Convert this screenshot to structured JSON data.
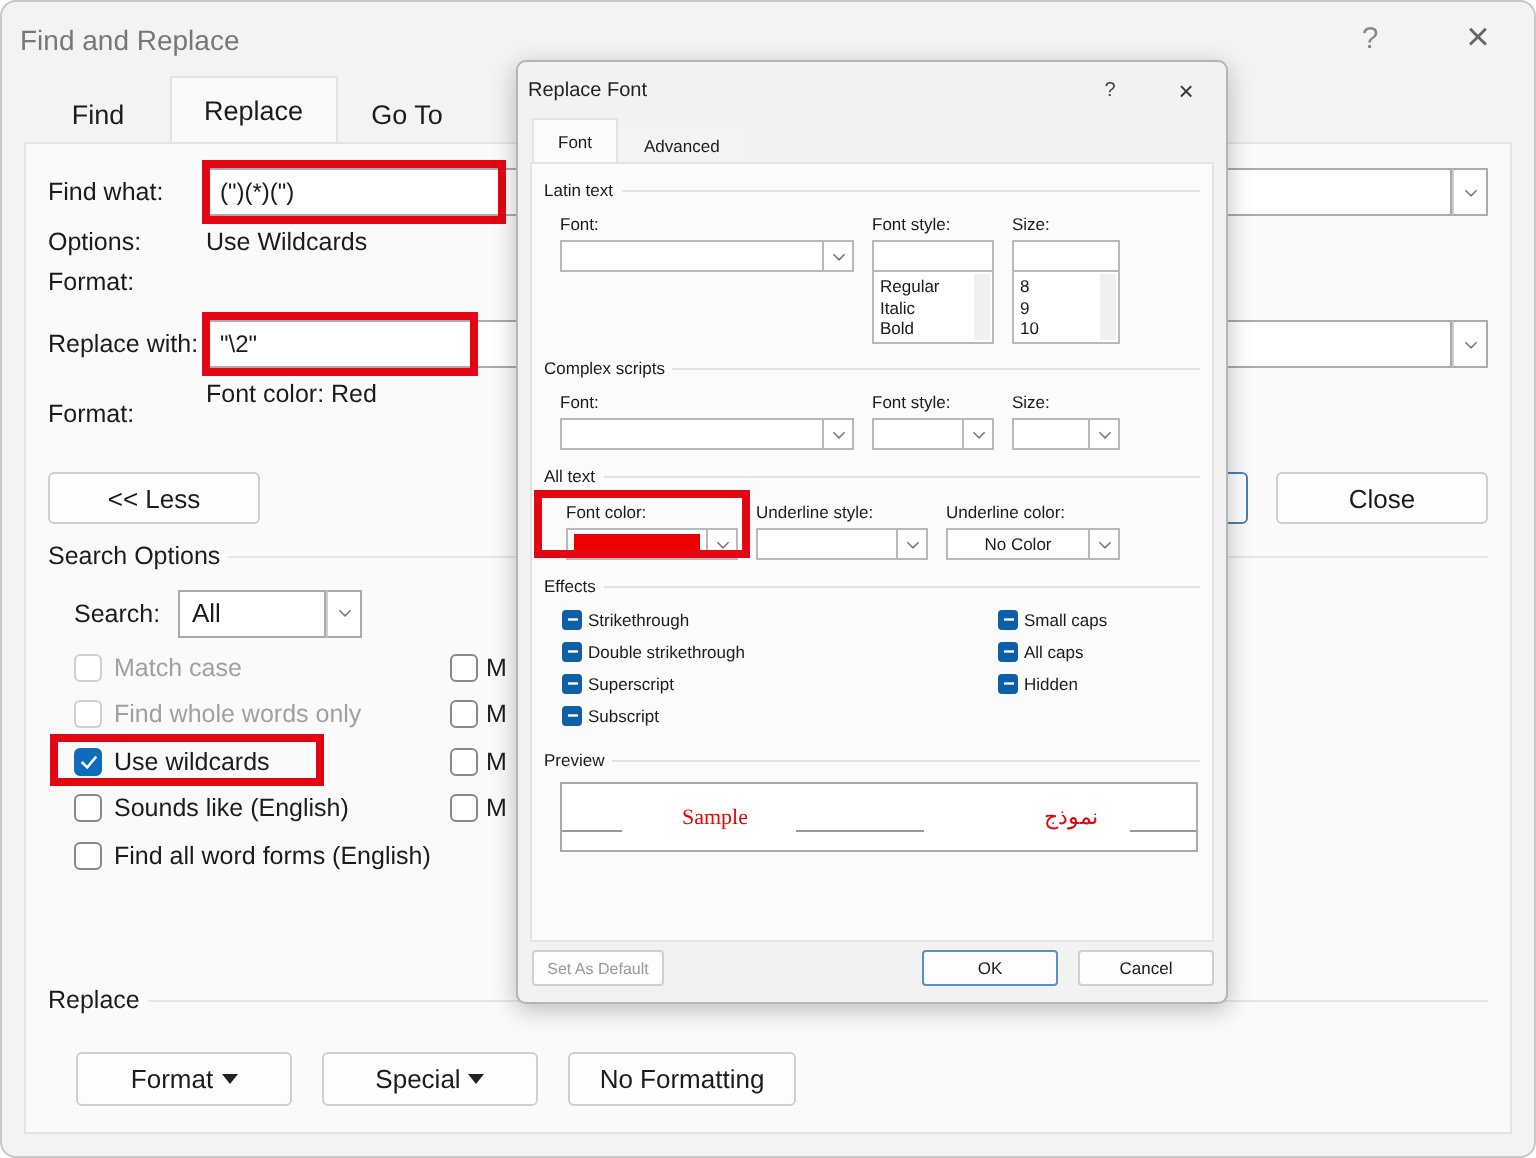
{
  "window": {
    "title": "Find and Replace",
    "help": "?",
    "close": "×"
  },
  "tabs": [
    {
      "label": "Find",
      "selected": false
    },
    {
      "label": "Replace",
      "selected": true
    },
    {
      "label": "Go To",
      "selected": false
    }
  ],
  "find": {
    "label": "Find what:",
    "value": "(\")(*)(\")",
    "highlighted": true,
    "options_label": "Options:",
    "options": "Use Wildcards",
    "format_label": "Format:"
  },
  "replace": {
    "label": "Replace with:",
    "value": "\"\\2\"",
    "highlighted": true,
    "format_label": "Format:",
    "format": "Font color: Red"
  },
  "less_button": "<< Less",
  "close_button": "Close",
  "search_options": {
    "title": "Search Options",
    "search_label": "Search:",
    "search_value": "All"
  },
  "checkboxes_left": [
    {
      "label": "Match case",
      "checked": false,
      "disabled": true
    },
    {
      "label": "Find whole words only",
      "checked": false,
      "disabled": true
    },
    {
      "label": "Use wildcards",
      "checked": true,
      "disabled": false,
      "highlighted": true
    },
    {
      "label": "Sounds like (English)",
      "checked": false,
      "disabled": false
    },
    {
      "label": "Find all word forms (English)",
      "checked": false,
      "disabled": false
    }
  ],
  "checkboxes_right": [
    {
      "label": "M",
      "checked": false
    },
    {
      "label": "M",
      "checked": false
    },
    {
      "label": "M",
      "checked": false
    },
    {
      "label": "M",
      "checked": false
    }
  ],
  "replace_section": {
    "title": "Replace",
    "buttons": [
      {
        "label": "Format",
        "dropdown": true
      },
      {
        "label": "Special",
        "dropdown": true
      },
      {
        "label": "No Formatting",
        "dropdown": false
      }
    ]
  },
  "font_dialog": {
    "title": "Replace Font",
    "help": "?",
    "close": "×",
    "tabs": [
      {
        "label": "Font",
        "selected": true
      },
      {
        "label": "Advanced",
        "selected": false
      }
    ],
    "latin": {
      "title": "Latin text",
      "font_label": "Font:",
      "style_label": "Font style:",
      "size_label": "Size:",
      "styles": [
        "Regular",
        "Italic",
        "Bold"
      ],
      "sizes": [
        "8",
        "9",
        "10"
      ]
    },
    "complex": {
      "title": "Complex scripts",
      "font_label": "Font:",
      "style_label": "Font style:",
      "size_label": "Size:"
    },
    "all_text": {
      "title": "All text",
      "font_color_label": "Font color:",
      "color": "#ee0000",
      "font_color_highlighted": true,
      "underline_style_label": "Underline style:",
      "underline_color_label": "Underline color:",
      "underline_color": "No Color"
    },
    "effects": {
      "title": "Effects",
      "left": [
        {
          "label": "Strikethrough",
          "indeterminate": true
        },
        {
          "label": "Double strikethrough",
          "indeterminate": true
        },
        {
          "label": "Superscript",
          "indeterminate": true
        },
        {
          "label": "Subscript",
          "indeterminate": true
        }
      ],
      "right": [
        {
          "label": "Small caps",
          "indeterminate": true
        },
        {
          "label": "All caps",
          "indeterminate": true
        },
        {
          "label": "Hidden",
          "indeterminate": true
        }
      ]
    },
    "preview": {
      "title": "Preview",
      "sample": "Sample",
      "sample_rtl": "نموذج"
    },
    "buttons": [
      {
        "label": "Set As Default",
        "kind": "secondary",
        "disabled": true
      },
      {
        "label": "OK",
        "kind": "default",
        "disabled": false
      },
      {
        "label": "Cancel",
        "kind": "normal",
        "disabled": false
      }
    ]
  }
}
